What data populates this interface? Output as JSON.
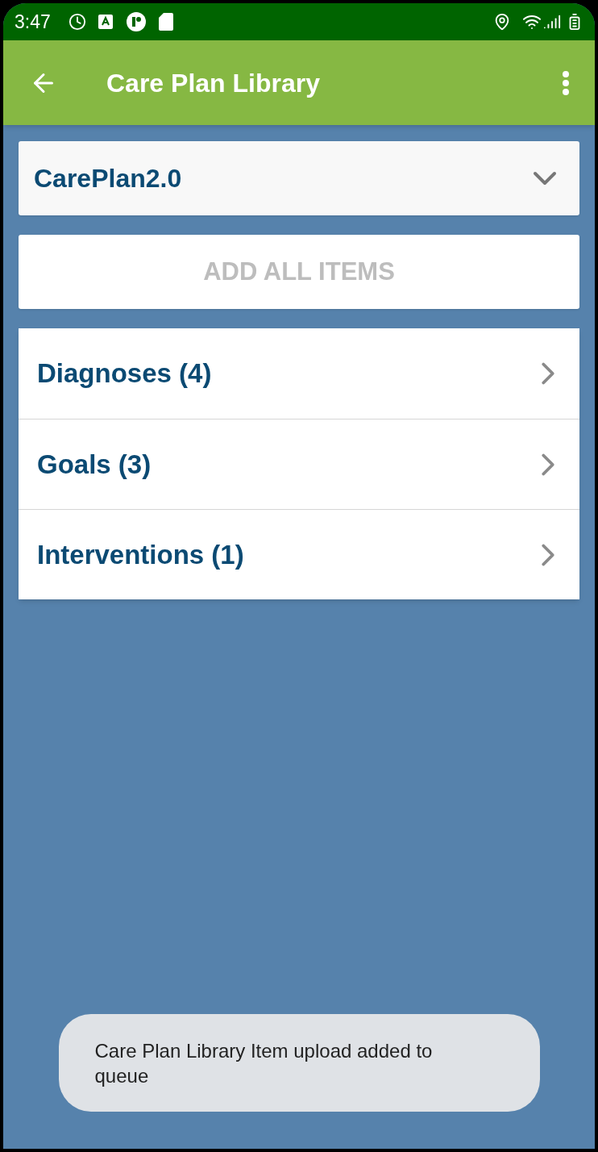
{
  "status_bar": {
    "time": "3:47"
  },
  "app_bar": {
    "title": "Care Plan Library"
  },
  "dropdown": {
    "value": "CarePlan2.0"
  },
  "add_all_button": {
    "label": "ADD ALL ITEMS",
    "disabled": true
  },
  "categories": [
    {
      "label": "Diagnoses (4)"
    },
    {
      "label": "Goals (3)"
    },
    {
      "label": "Interventions (1)"
    }
  ],
  "toast": {
    "message": "Care Plan Library Item upload added to queue"
  }
}
